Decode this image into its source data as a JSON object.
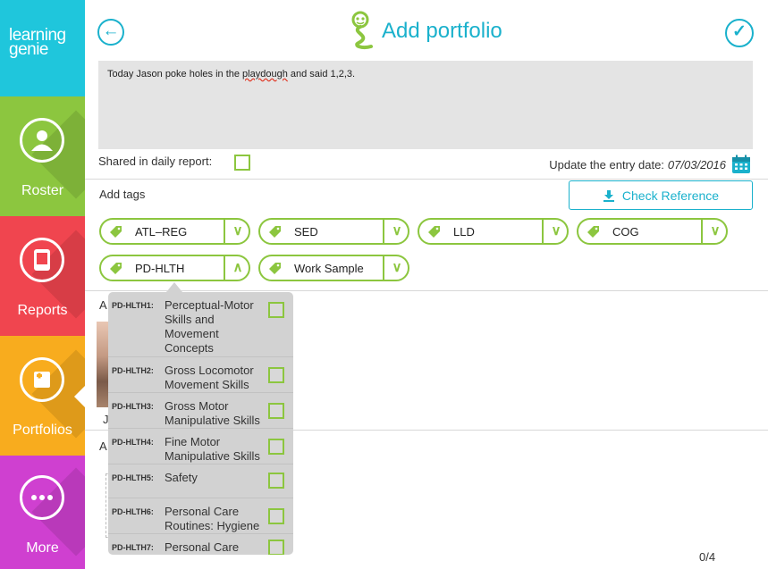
{
  "app": {
    "logo_text": "learning genie"
  },
  "sidebar": {
    "items": [
      {
        "label": "Roster",
        "icon": "person-icon",
        "color": "#8cc63f"
      },
      {
        "label": "Reports",
        "icon": "report-icon",
        "color": "#f0454f"
      },
      {
        "label": "Portfolios",
        "icon": "portfolio-icon",
        "color": "#f8ac1e",
        "active": true
      },
      {
        "label": "More",
        "icon": "ellipsis-icon",
        "color": "#cf40d0"
      }
    ]
  },
  "header": {
    "title": "Add portfolio",
    "accent": "#1ab1cc"
  },
  "note": {
    "text_before": "Today Jason poke holes in the ",
    "misspelled": "playdough",
    "text_after": " and said 1,2,3."
  },
  "shared": {
    "label": "Shared in daily report:",
    "checked": false
  },
  "entry_date": {
    "label": "Update the entry date:",
    "value": "07/03/2016"
  },
  "tags": {
    "label": "Add tags",
    "check_reference": "Check Reference",
    "items": [
      {
        "label": "ATL–REG",
        "expanded": false
      },
      {
        "label": "SED",
        "expanded": false
      },
      {
        "label": "LLD",
        "expanded": false
      },
      {
        "label": "COG",
        "expanded": false
      },
      {
        "label": "PD-HLTH",
        "expanded": true
      },
      {
        "label": "Work Sample",
        "expanded": false
      }
    ]
  },
  "background": {
    "section1_label_fragment": "A",
    "child_initial": "J",
    "section2_label_fragment": "A",
    "counter": "0/4"
  },
  "dropdown": {
    "items": [
      {
        "code": "PD-HLTH1:",
        "text": "Perceptual-Motor Skills and Movement Concepts",
        "checked": false
      },
      {
        "code": "PD-HLTH2:",
        "text": "Gross Locomotor Movement Skills",
        "checked": false
      },
      {
        "code": "PD-HLTH3:",
        "text": "Gross Motor Manipulative Skills",
        "checked": false
      },
      {
        "code": "PD-HLTH4:",
        "text": "Fine Motor Manipulative Skills",
        "checked": false
      },
      {
        "code": "PD-HLTH5:",
        "text": "Safety",
        "checked": false
      },
      {
        "code": "PD-HLTH6:",
        "text": "Personal Care Routines: Hygiene",
        "checked": false
      },
      {
        "code": "PD-HLTH7:",
        "text": "Personal Care Routines: Feeding",
        "checked": false
      }
    ]
  }
}
